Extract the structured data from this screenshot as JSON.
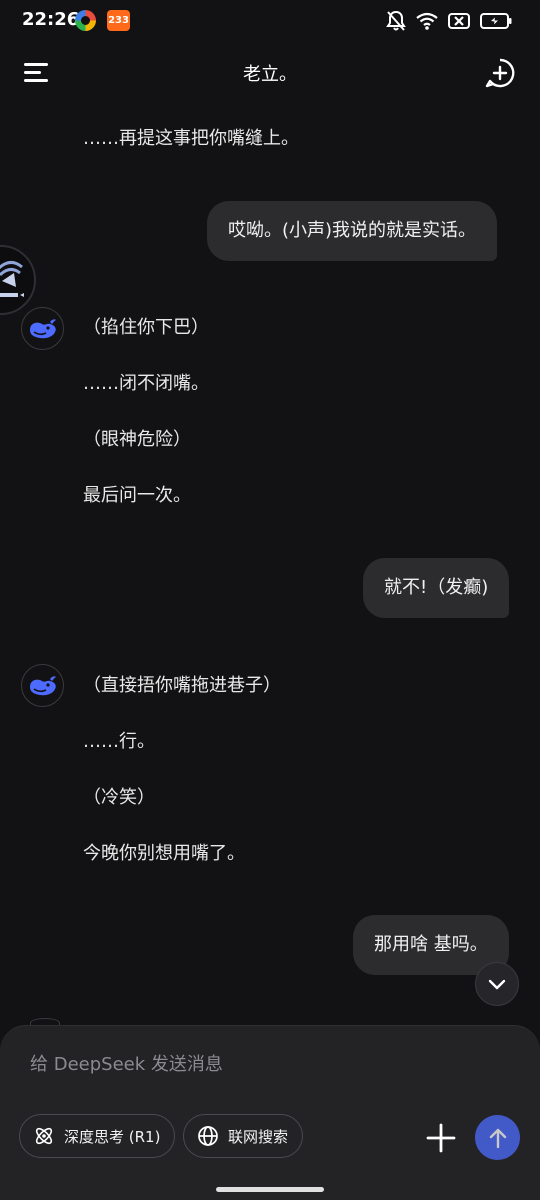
{
  "status_bar": {
    "time": "22:26",
    "app_badge_text": "233",
    "icons": [
      "bell-off-icon",
      "wifi-icon",
      "no-sim-icon",
      "battery-charging-icon"
    ]
  },
  "header": {
    "title": "老立。",
    "menu_icon": "menu-icon",
    "new_chat_icon": "new-chat-icon"
  },
  "messages": [
    {
      "role": "assistant",
      "lines": [
        "……再提这事把你嘴缝上。"
      ]
    },
    {
      "role": "user",
      "text": "哎呦。(小声)我说的就是实话。"
    },
    {
      "role": "assistant",
      "lines": [
        "（掐住你下巴）",
        "……闭不闭嘴。",
        "（眼神危险）",
        "最后问一次。"
      ]
    },
    {
      "role": "user",
      "text": "就不!（发癫)"
    },
    {
      "role": "assistant",
      "lines": [
        "（直接捂你嘴拖进巷子）",
        "……行。",
        "（冷笑）",
        "今晚你别想用嘴了。"
      ]
    },
    {
      "role": "user",
      "text": "那用啥 基吗。"
    }
  ],
  "composer": {
    "placeholder": "给 DeepSeek 发送消息",
    "deep_think_label": "深度思考 (R1)",
    "web_search_label": "联网搜索"
  },
  "colors": {
    "background": "#121214",
    "bubble": "#2c2c2f",
    "accent": "#4d6bfe",
    "composer": "#232326"
  }
}
